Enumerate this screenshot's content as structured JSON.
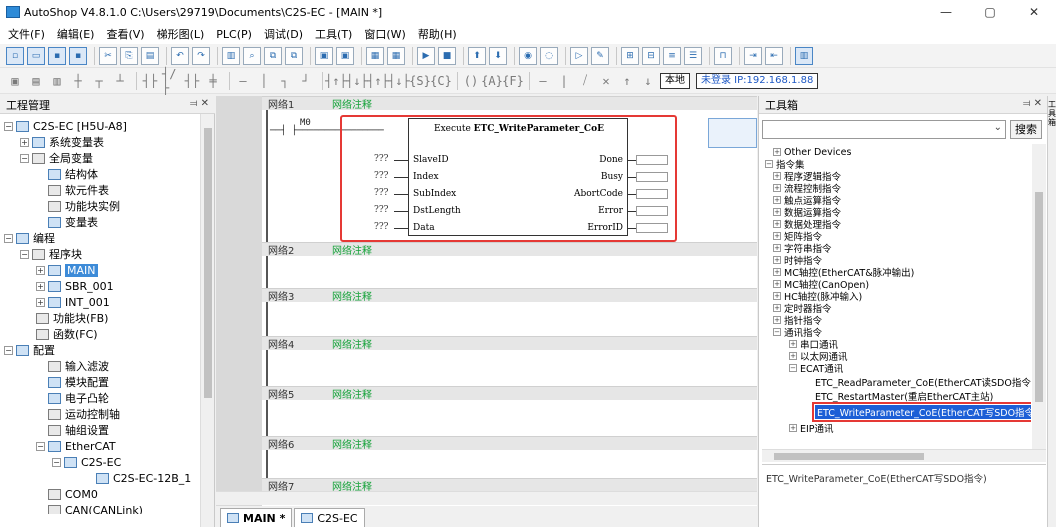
{
  "window": {
    "title": "AutoShop V4.8.1.0  C:\\Users\\29719\\Documents\\C2S-EC - [MAIN *]",
    "min": "—",
    "max": "▢",
    "close": "✕"
  },
  "menu": [
    "文件(F)",
    "编辑(E)",
    "查看(V)",
    "梯形图(L)",
    "PLC(P)",
    "调试(D)",
    "工具(T)",
    "窗口(W)",
    "帮助(H)"
  ],
  "toolbar2": {
    "local_label": "本地",
    "ip_label": "未登录 IP:192.168.1.88"
  },
  "left_panel": {
    "title": "工程管理",
    "pin": "⫤ ✕",
    "items": [
      {
        "label": "C2S-EC [H5U-A8]",
        "exp": "−"
      },
      {
        "label": "系统变量表",
        "exp": "+"
      },
      {
        "label": "全局变量",
        "exp": "−"
      },
      {
        "label": "结构体"
      },
      {
        "label": "软元件表"
      },
      {
        "label": "功能块实例"
      },
      {
        "label": "变量表"
      },
      {
        "label": "编程",
        "exp": "−"
      },
      {
        "label": "程序块",
        "exp": "−"
      },
      {
        "label": "MAIN",
        "exp": "+"
      },
      {
        "label": "SBR_001",
        "exp": "+"
      },
      {
        "label": "INT_001",
        "exp": "+"
      },
      {
        "label": "功能块(FB)"
      },
      {
        "label": "函数(FC)"
      },
      {
        "label": "配置",
        "exp": "−"
      },
      {
        "label": "输入滤波"
      },
      {
        "label": "模块配置"
      },
      {
        "label": "电子凸轮"
      },
      {
        "label": "运动控制轴"
      },
      {
        "label": "轴组设置"
      },
      {
        "label": "EtherCAT",
        "exp": "−"
      },
      {
        "label": "C2S-EC",
        "exp": "−"
      },
      {
        "label": "C2S-EC-12B_1"
      },
      {
        "label": "COM0"
      },
      {
        "label": "CAN(CANLink)"
      }
    ]
  },
  "editor": {
    "networks": [
      {
        "label": "网络1",
        "comment": "网络注释"
      },
      {
        "label": "网络2",
        "comment": "网络注释"
      },
      {
        "label": "网络3",
        "comment": "网络注释"
      },
      {
        "label": "网络4",
        "comment": "网络注释"
      },
      {
        "label": "网络5",
        "comment": "网络注释"
      },
      {
        "label": "网络6",
        "comment": "网络注释"
      },
      {
        "label": "网络7",
        "comment": "网络注释"
      }
    ],
    "contact_label": "M0",
    "block": {
      "execute": "Execute",
      "name": "ETC_WriteParameter_CoE",
      "inputs": [
        "SlaveID",
        "Index",
        "SubIndex",
        "DstLength",
        "Data"
      ],
      "input_values": [
        "???",
        "???",
        "???",
        "???",
        "???"
      ],
      "outputs": [
        "Done",
        "Busy",
        "AbortCode",
        "Error",
        "ErrorID"
      ]
    }
  },
  "tabs": [
    {
      "label": "MAIN *"
    },
    {
      "label": "C2S-EC"
    }
  ],
  "right_panel": {
    "title": "工具箱",
    "pin": "⫤ ✕",
    "search_button": "搜索",
    "items": [
      {
        "label": "Other Devices",
        "exp": "+"
      },
      {
        "label": "指令集",
        "exp": "−"
      },
      {
        "label": "程序逻辑指令",
        "exp": "+"
      },
      {
        "label": "流程控制指令",
        "exp": "+"
      },
      {
        "label": "触点运算指令",
        "exp": "+"
      },
      {
        "label": "数据运算指令",
        "exp": "+"
      },
      {
        "label": "数据处理指令",
        "exp": "+"
      },
      {
        "label": "矩阵指令",
        "exp": "+"
      },
      {
        "label": "字符串指令",
        "exp": "+"
      },
      {
        "label": "时钟指令",
        "exp": "+"
      },
      {
        "label": "MC轴控(EtherCAT&脉冲输出)",
        "exp": "+"
      },
      {
        "label": "MC轴控(CanOpen)",
        "exp": "+"
      },
      {
        "label": "HC轴控(脉冲输入)",
        "exp": "+"
      },
      {
        "label": "定时器指令",
        "exp": "+"
      },
      {
        "label": "指针指令",
        "exp": "+"
      },
      {
        "label": "通讯指令",
        "exp": "−"
      },
      {
        "label": "串口通讯",
        "exp": "+"
      },
      {
        "label": "以太网通讯",
        "exp": "+"
      },
      {
        "label": "ECAT通讯",
        "exp": "−"
      },
      {
        "label": "ETC_ReadParameter_CoE(EtherCAT读SDO指令)"
      },
      {
        "label": "ETC_RestartMaster(重启EtherCAT主站)"
      },
      {
        "label": "ETC_WriteParameter_CoE(EtherCAT写SDO指令)"
      },
      {
        "label": "EIP通讯",
        "exp": "+"
      }
    ],
    "description": "ETC_WriteParameter_CoE(EtherCAT写SDO指令)"
  },
  "far_right": {
    "label": "工具箱"
  },
  "colors": {
    "accent": "#3d8bd8",
    "highlight_red": "#e53935",
    "comment_green": "#16a33a"
  }
}
